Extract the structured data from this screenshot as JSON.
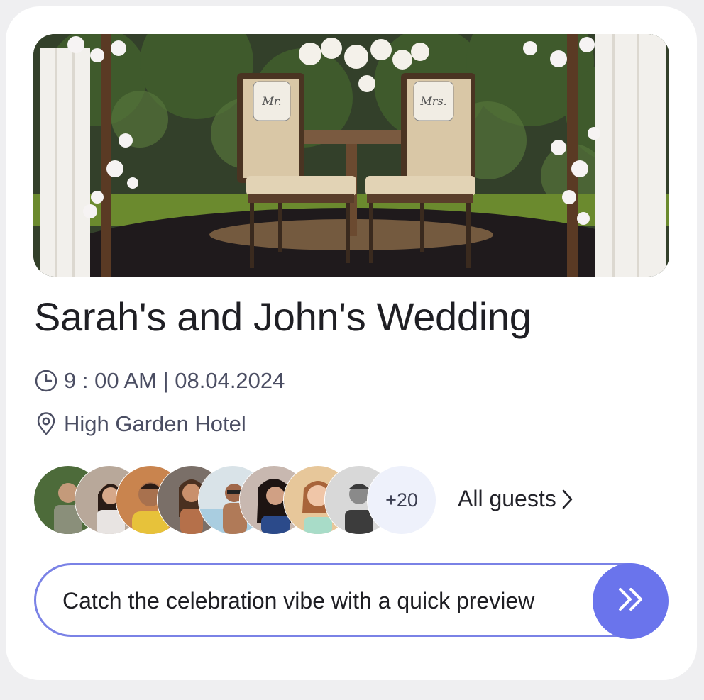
{
  "event": {
    "title": "Sarah's and John's Wedding",
    "time": "9 : 00 AM | 08.04.2024",
    "location": "High Garden Hotel"
  },
  "hero": {
    "image_description": "wedding-chairs-photo",
    "sign_left": "Mr.",
    "sign_right": "Mrs."
  },
  "guests": {
    "avatar_count_shown": 8,
    "more_count": "+20",
    "all_guests_label": "All guests"
  },
  "preview": {
    "label": "Catch the celebration vibe with a quick preview"
  },
  "icons": {
    "time": "clock-icon",
    "location": "location-pin-icon",
    "all_guests": "chevron-right-icon",
    "preview": "double-chevron-right-icon"
  },
  "colors": {
    "accent": "#6a74ec",
    "accent_border": "#7a82e6",
    "text_primary": "#1f1f24",
    "text_secondary": "#4b4e63",
    "more_badge_bg": "#eef1fb"
  }
}
